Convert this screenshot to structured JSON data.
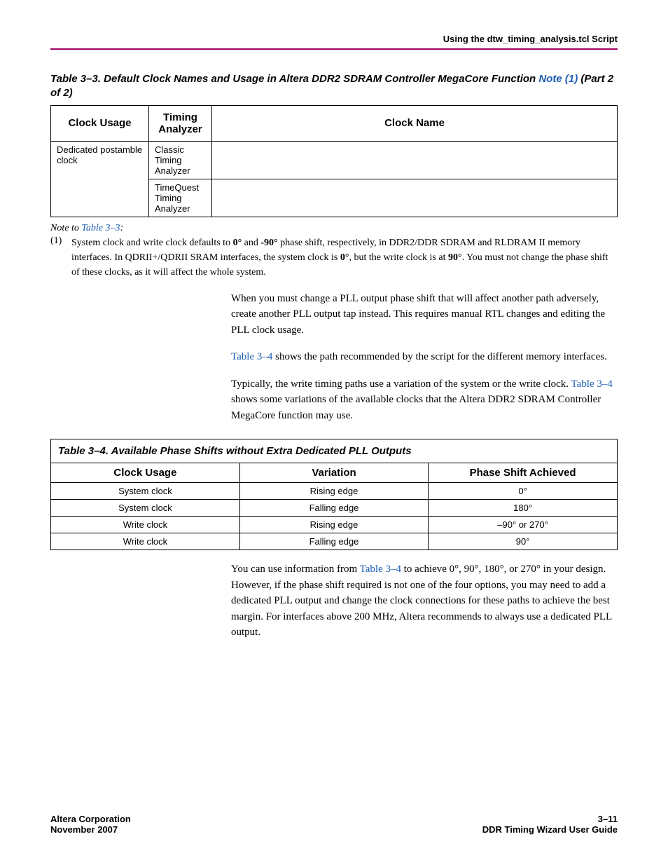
{
  "header": {
    "running_head": "Using the dtw_timing_analysis.tcl Script"
  },
  "table3_3": {
    "title_prefix": "Table 3–3. Default Clock Names and Usage in Altera DDR2 SDRAM Controller MegaCore Function ",
    "title_notelink": "Note (1)",
    "title_suffix": "  (Part 2 of 2)",
    "columns": {
      "usage": "Clock Usage",
      "analyzer": "Timing Analyzer",
      "clockname": "Clock Name"
    },
    "rows": [
      {
        "usage": "Dedicated postamble clock",
        "analyzer": "Classic Timing Analyzer",
        "clockname": ""
      },
      {
        "analyzer": "TimeQuest Timing Analyzer",
        "clockname": ""
      }
    ]
  },
  "note": {
    "heading_prefix": "Note to ",
    "heading_link": "Table 3–3",
    "heading_suffix": ":",
    "num": "(1)",
    "text_parts": [
      "System clock and write clock defaults to ",
      "0°",
      " and ",
      "-90°",
      " phase shift, respectively, in DDR2/DDR SDRAM and RLDRAM II memory interfaces. In QDRII+/QDRII SRAM interfaces, the system clock is ",
      "0°",
      ", but the write clock is at ",
      "90°",
      ". You must not change the phase shift of these clocks, as it will affect the whole system."
    ]
  },
  "paras": {
    "p1": "When you must change a PLL output phase shift that will affect another path adversely, create another PLL output tap instead. This requires manual RTL changes and editing the PLL clock usage.",
    "p2a": "Table 3–4",
    "p2b": " shows the path recommended by the script for the different memory interfaces.",
    "p3a": "Typically, the write timing paths use a variation of the system or the write clock. ",
    "p3b": "Table 3–4",
    "p3c": " shows some variations of the available clocks that the Altera DDR2 SDRAM Controller MegaCore function may use.",
    "p4a": "You can use information from ",
    "p4b": "Table 3–4",
    "p4c": " to achieve 0°, 90°, 180°, or 270° in your design. However, if the phase shift required is not one of the four options, you may need to add a dedicated PLL output and change the clock connections for these paths to achieve the best margin. For interfaces above 200 MHz, Altera recommends to always use a dedicated PLL output."
  },
  "table3_4": {
    "title": "Table 3–4. Available Phase Shifts without Extra Dedicated PLL Outputs",
    "columns": {
      "usage": "Clock Usage",
      "variation": "Variation",
      "phase": "Phase Shift Achieved"
    },
    "rows": [
      {
        "usage": "System clock",
        "variation": "Rising edge",
        "phase": "0°"
      },
      {
        "usage": "System clock",
        "variation": "Falling edge",
        "phase": "180°"
      },
      {
        "usage": "Write clock",
        "variation": "Rising edge",
        "phase": "–90° or 270°"
      },
      {
        "usage": "Write clock",
        "variation": "Falling edge",
        "phase": "90°"
      }
    ]
  },
  "footer": {
    "left1": "Altera Corporation",
    "left2": "November 2007",
    "right1": "3–11",
    "right2": "DDR Timing Wizard User Guide"
  }
}
